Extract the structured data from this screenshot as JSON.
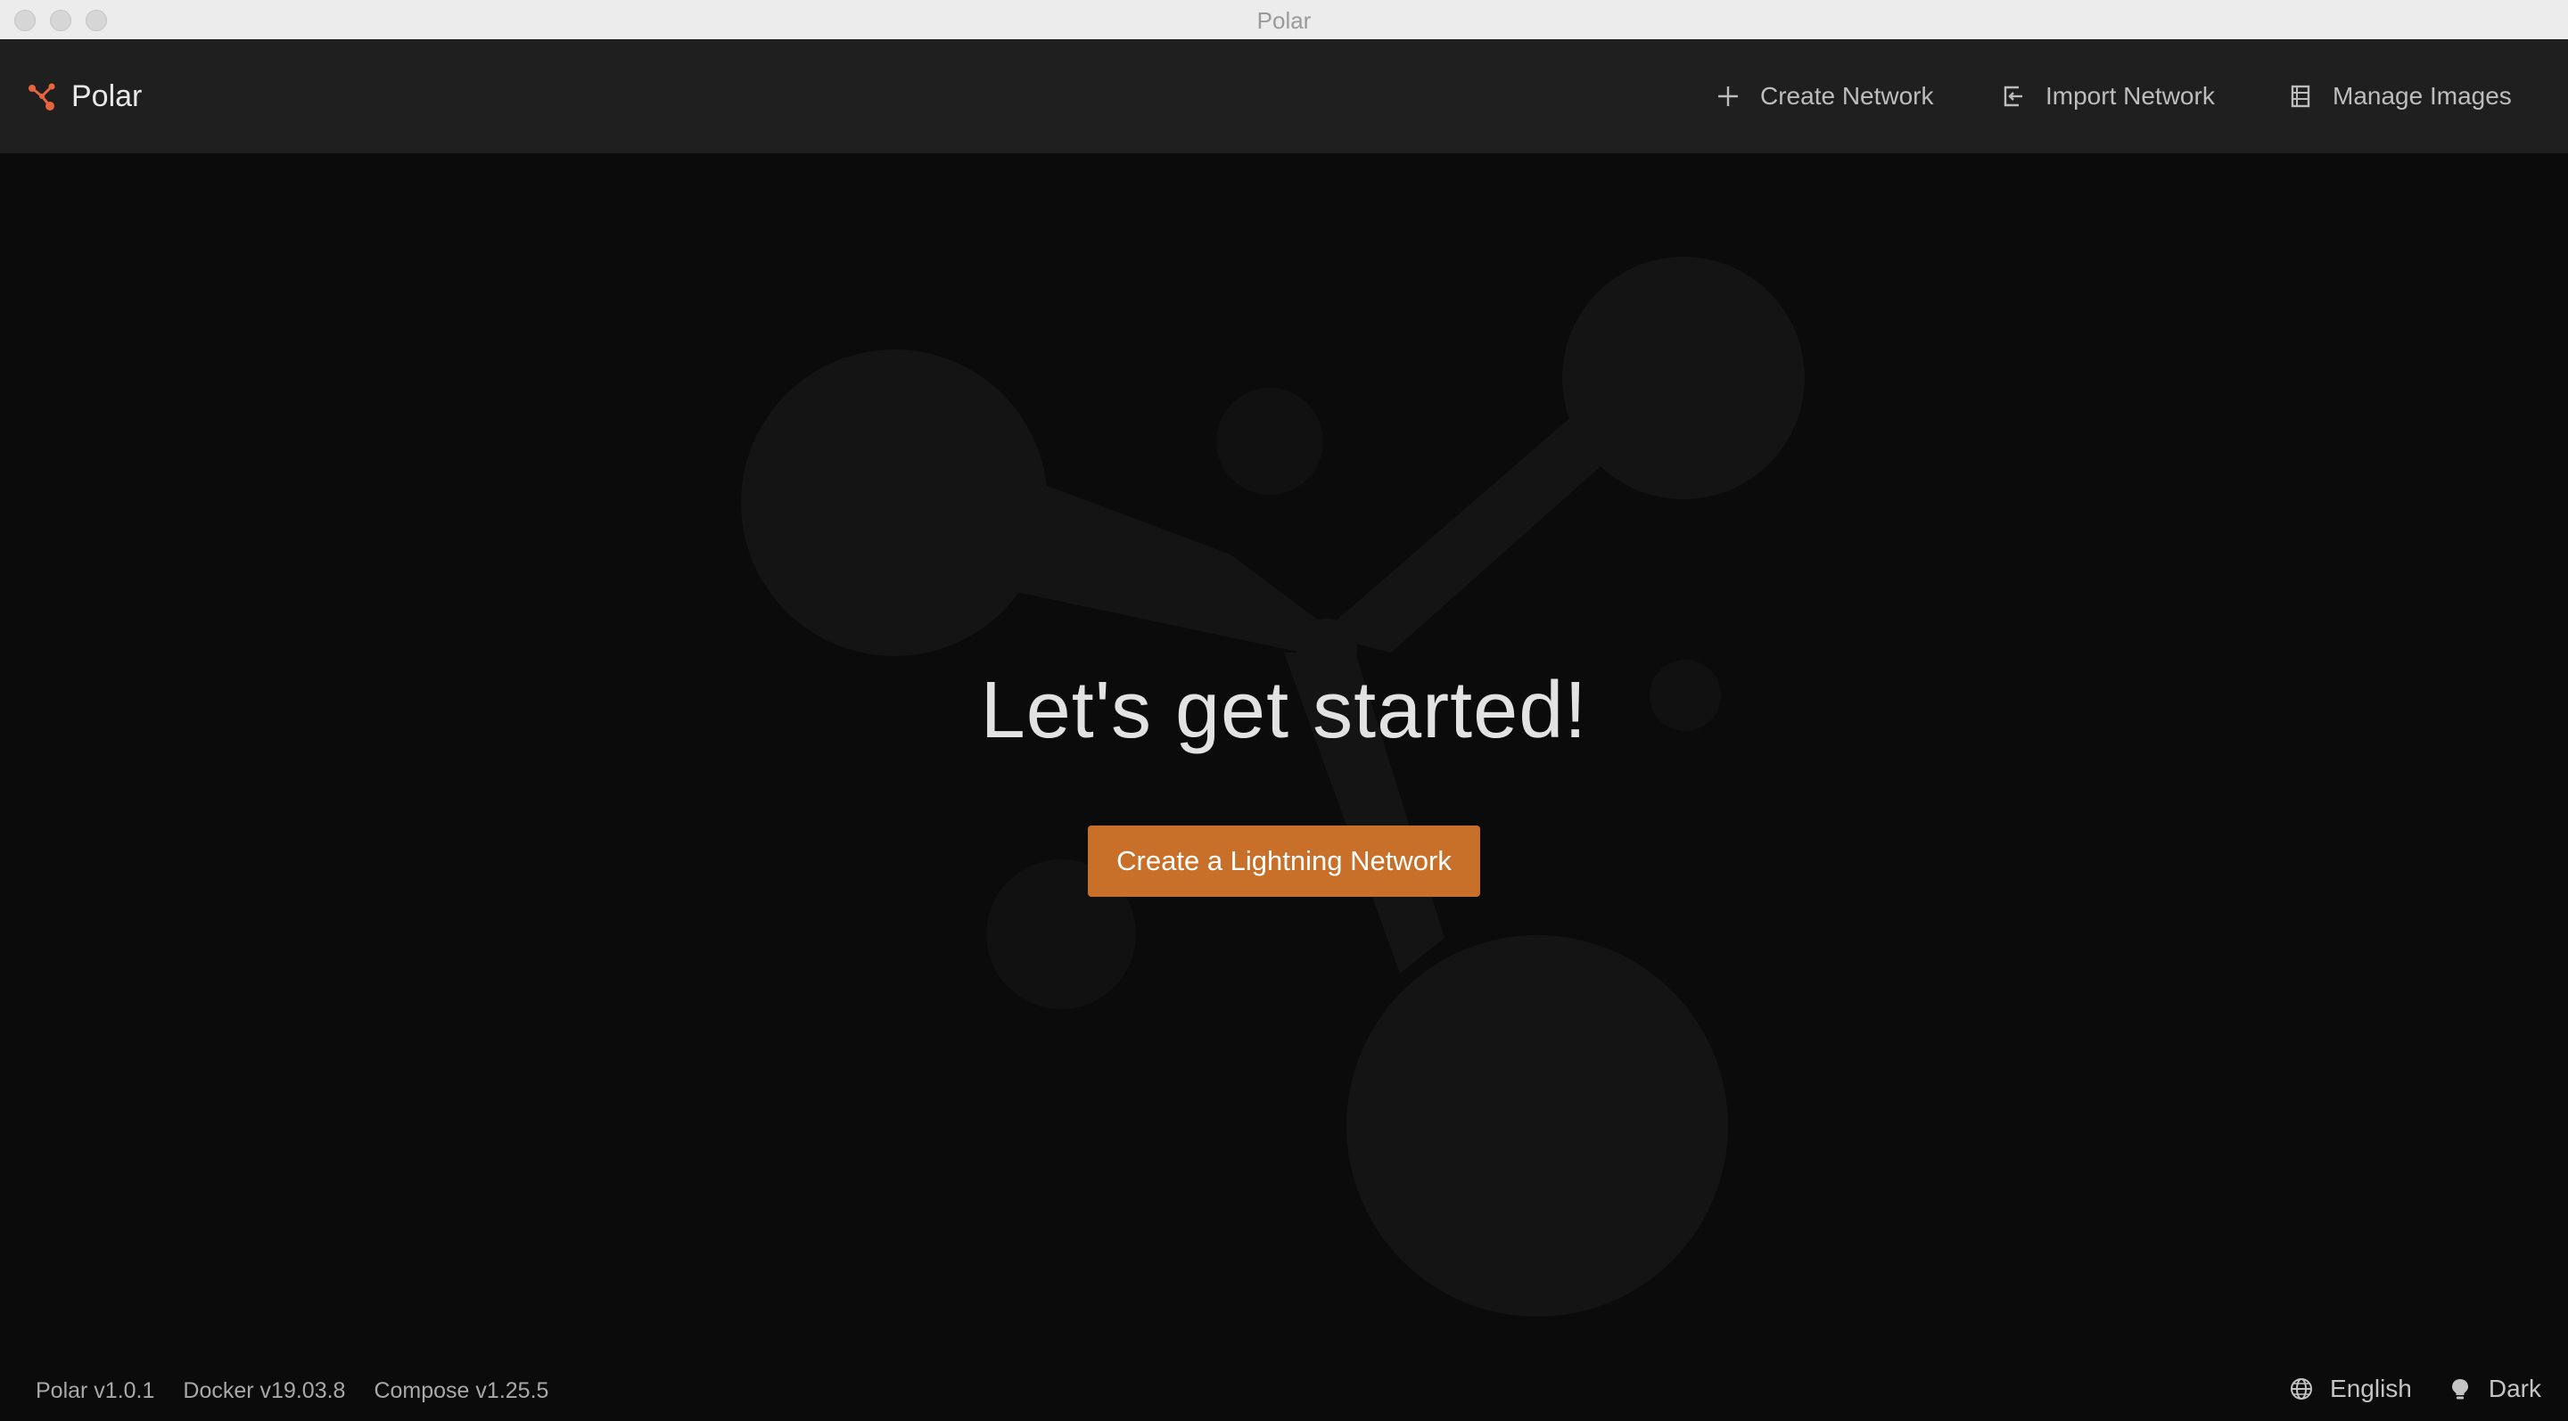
{
  "window": {
    "title": "Polar"
  },
  "header": {
    "brand": "Polar",
    "brand_icon": "polar-logo-icon",
    "nav": [
      {
        "label": "Create Network",
        "icon": "plus-icon"
      },
      {
        "label": "Import Network",
        "icon": "import-icon"
      },
      {
        "label": "Manage Images",
        "icon": "images-icon"
      }
    ]
  },
  "main": {
    "heading": "Let's get started!",
    "cta_label": "Create a Lightning Network"
  },
  "footer": {
    "versions": [
      "Polar v1.0.1",
      "Docker v19.03.8",
      "Compose v1.25.5"
    ],
    "language": "English",
    "theme": "Dark"
  },
  "colors": {
    "accent": "#c8702a",
    "brand_icon": "#e8643c",
    "background": "#0b0b0b",
    "header": "#1f1f1f"
  }
}
